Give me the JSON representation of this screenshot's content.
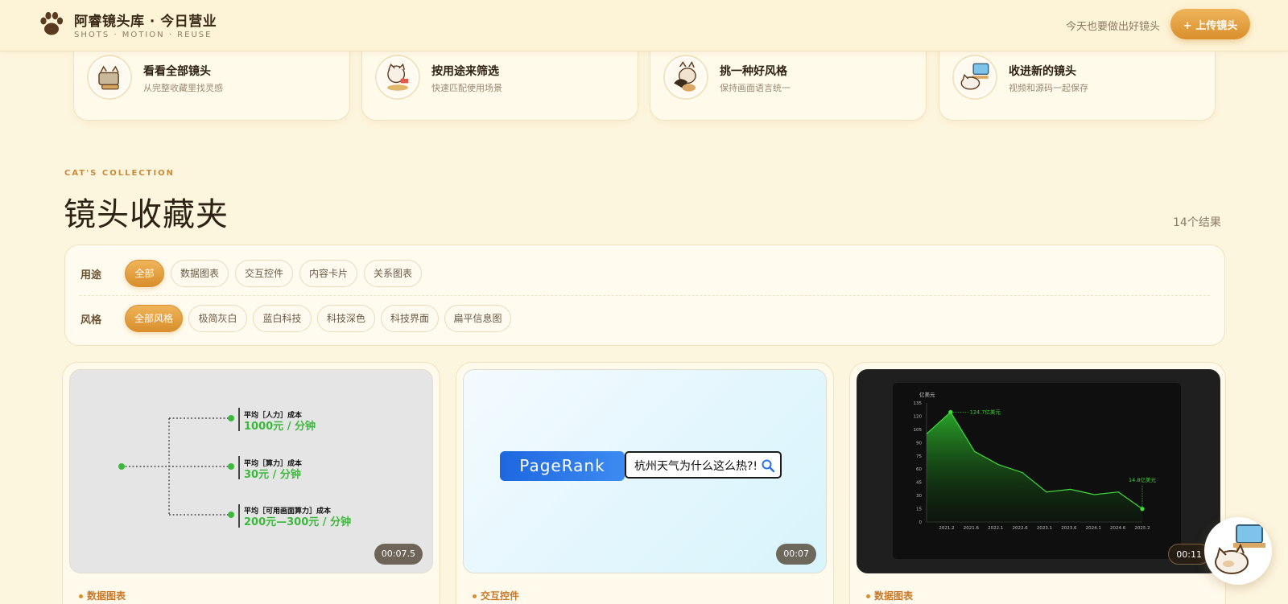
{
  "header": {
    "brand_title": "阿睿镜头库 · 今日营业",
    "brand_subtitle": "SHOTS · MOTION · REUSE",
    "tagline": "今天也要做出好镜头",
    "upload_label": "+ 上传镜头"
  },
  "quick_cards": [
    {
      "title": "看看全部镜头",
      "desc": "从完整收藏里找灵感"
    },
    {
      "title": "按用途来筛选",
      "desc": "快速匹配使用场景"
    },
    {
      "title": "挑一种好风格",
      "desc": "保持画面语言统一"
    },
    {
      "title": "收进新的镜头",
      "desc": "视频和源码一起保存"
    }
  ],
  "section": {
    "eyebrow": "CAT'S COLLECTION",
    "title": "镜头收藏夹",
    "result_count": "14个结果"
  },
  "filters": {
    "purpose_label": "用途",
    "purpose_options": [
      "全部",
      "数据图表",
      "交互控件",
      "内容卡片",
      "关系图表"
    ],
    "style_label": "风格",
    "style_options": [
      "全部风格",
      "极简灰白",
      "蓝白科技",
      "科技深色",
      "科技界面",
      "扁平信息图"
    ]
  },
  "cards": [
    {
      "duration": "00:07.5",
      "tag": "数据图表",
      "tree": {
        "items": [
          {
            "label": "平均［人力］成本",
            "value": "1000元 / 分钟"
          },
          {
            "label": "平均［算力］成本",
            "value": "30元 / 分钟"
          },
          {
            "label": "平均［可用画面算力］成本",
            "value": "200元—300元 / 分钟"
          }
        ]
      }
    },
    {
      "duration": "00:07",
      "tag": "交互控件",
      "search": {
        "brand": "PageRank",
        "query": "杭州天气为什么这么热?!"
      }
    },
    {
      "duration": "00:11",
      "tag": "数据图表",
      "chart": {
        "unit": "亿美元",
        "peak_label": "124.7亿美元",
        "end_label": "14.8亿美元"
      }
    }
  ],
  "chart_data": {
    "type": "area",
    "title": "",
    "ylabel": "亿美元",
    "x": [
      "2021.2",
      "2021.6",
      "2022.1",
      "2022.6",
      "2023.1",
      "2023.6",
      "2024.1",
      "2024.6",
      "2025.2"
    ],
    "series": [
      {
        "values": [
          100,
          124.7,
          80,
          65,
          56,
          34,
          37,
          31,
          34,
          14.8
        ]
      }
    ],
    "yticks": [
      0,
      15,
      30,
      45,
      60,
      75,
      90,
      105,
      120,
      135
    ],
    "ylim": [
      0,
      135
    ],
    "annotations": [
      "124.7亿美元",
      "14.8亿美元"
    ],
    "grid": false,
    "color": "#3fdc3a"
  },
  "colors": {
    "accent": "#d98f2c",
    "background": "#fdf6df",
    "green": "#3cb93c"
  }
}
